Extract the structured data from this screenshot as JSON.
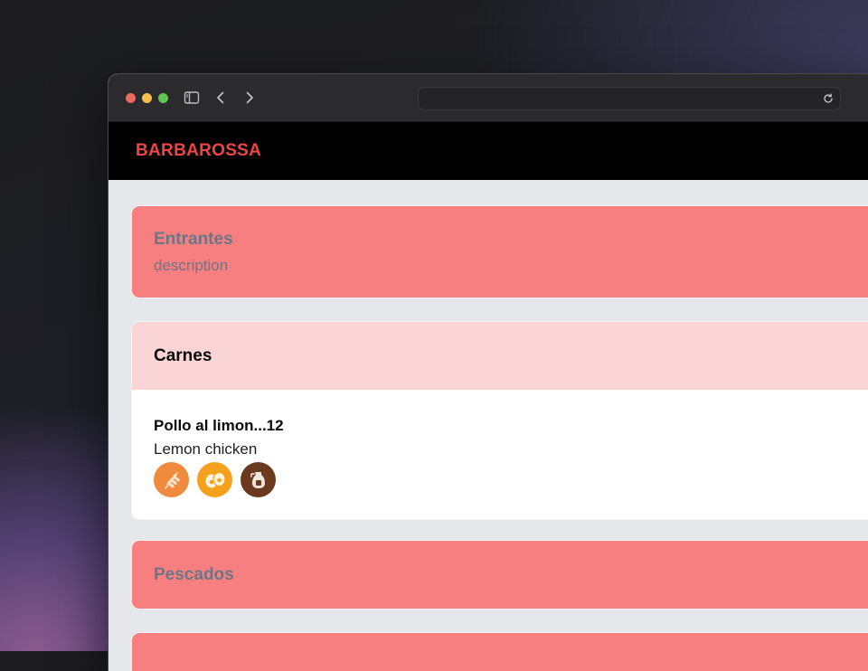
{
  "browser": {
    "url": ""
  },
  "site": {
    "brand": "BARBAROSSA"
  },
  "sections": [
    {
      "title": "Entrantes",
      "description": "description",
      "expanded": false
    },
    {
      "title": "Carnes",
      "expanded": true,
      "items": [
        {
          "title": "Pollo al limon...12",
          "description": "Lemon chicken",
          "allergens": [
            "gluten-icon",
            "eggs-icon",
            "milk-icon"
          ]
        }
      ]
    },
    {
      "title": "Pescados",
      "expanded": false
    }
  ],
  "colors": {
    "brand": "#ef4444",
    "section_collapsed": "#f87f7f",
    "section_expanded": "#fbd5d5",
    "gluten": "#f08a3c",
    "eggs": "#f4a21e",
    "milk": "#6b3a1e"
  }
}
